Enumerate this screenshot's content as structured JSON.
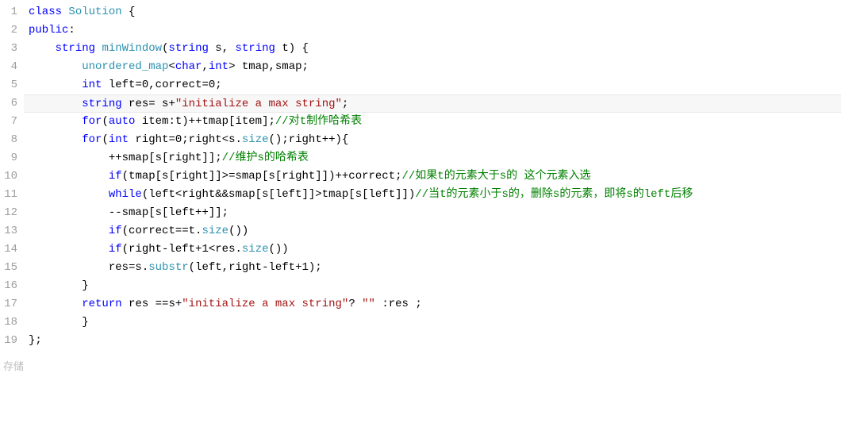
{
  "line_numbers": [
    "1",
    "2",
    "3",
    "4",
    "5",
    "6",
    "7",
    "8",
    "9",
    "10",
    "11",
    "12",
    "13",
    "14",
    "15",
    "16",
    "17",
    "18",
    "19"
  ],
  "code_lines": [
    [
      {
        "t": "class ",
        "c": "kw"
      },
      {
        "t": "Solution",
        "c": "type"
      },
      {
        "t": " {",
        "c": ""
      }
    ],
    [
      {
        "t": "public",
        "c": "kw"
      },
      {
        "t": ":",
        "c": ""
      }
    ],
    [
      {
        "t": "    ",
        "c": ""
      },
      {
        "t": "string",
        "c": "kw"
      },
      {
        "t": " ",
        "c": ""
      },
      {
        "t": "minWindow",
        "c": "type"
      },
      {
        "t": "(",
        "c": ""
      },
      {
        "t": "string",
        "c": "kw"
      },
      {
        "t": " s, ",
        "c": ""
      },
      {
        "t": "string",
        "c": "kw"
      },
      {
        "t": " t) {",
        "c": ""
      }
    ],
    [
      {
        "t": "        ",
        "c": ""
      },
      {
        "t": "unordered_map",
        "c": "type"
      },
      {
        "t": "<",
        "c": ""
      },
      {
        "t": "char",
        "c": "kw"
      },
      {
        "t": ",",
        "c": ""
      },
      {
        "t": "int",
        "c": "kw"
      },
      {
        "t": "> tmap,smap;",
        "c": ""
      }
    ],
    [
      {
        "t": "        ",
        "c": ""
      },
      {
        "t": "int",
        "c": "kw"
      },
      {
        "t": " left=",
        "c": ""
      },
      {
        "t": "0",
        "c": "num"
      },
      {
        "t": ",correct=",
        "c": ""
      },
      {
        "t": "0",
        "c": "num"
      },
      {
        "t": ";",
        "c": ""
      }
    ],
    [
      {
        "t": "        ",
        "c": ""
      },
      {
        "t": "string",
        "c": "kw"
      },
      {
        "t": " res= s+",
        "c": ""
      },
      {
        "t": "\"initialize a max string\"",
        "c": "str"
      },
      {
        "t": ";",
        "c": ""
      }
    ],
    [
      {
        "t": "        ",
        "c": ""
      },
      {
        "t": "for",
        "c": "kw"
      },
      {
        "t": "(",
        "c": ""
      },
      {
        "t": "auto",
        "c": "kw"
      },
      {
        "t": " item:t)++tmap[item];",
        "c": ""
      },
      {
        "t": "//对t制作哈希表",
        "c": "cm"
      }
    ],
    [
      {
        "t": "        ",
        "c": ""
      },
      {
        "t": "for",
        "c": "kw"
      },
      {
        "t": "(",
        "c": ""
      },
      {
        "t": "int",
        "c": "kw"
      },
      {
        "t": " right=",
        "c": ""
      },
      {
        "t": "0",
        "c": "num"
      },
      {
        "t": ";right<s.",
        "c": ""
      },
      {
        "t": "size",
        "c": "type"
      },
      {
        "t": "();right++){",
        "c": ""
      }
    ],
    [
      {
        "t": "            ++smap[s[right]];",
        "c": ""
      },
      {
        "t": "//维护s的哈希表",
        "c": "cm"
      }
    ],
    [
      {
        "t": "            ",
        "c": ""
      },
      {
        "t": "if",
        "c": "kw"
      },
      {
        "t": "(tmap[s[right]]>=smap[s[right]])++correct;",
        "c": ""
      },
      {
        "t": "//如果t的元素大于s的 这个元素入选",
        "c": "cm"
      }
    ],
    [
      {
        "t": "            ",
        "c": ""
      },
      {
        "t": "while",
        "c": "kw"
      },
      {
        "t": "(left<right&&smap[s[left]]>tmap[s[left]])",
        "c": ""
      },
      {
        "t": "//当t的元素小于s的，删除s的元素，即将s的left后移",
        "c": "cm"
      }
    ],
    [
      {
        "t": "            --smap[s[left++]];",
        "c": ""
      }
    ],
    [
      {
        "t": "            ",
        "c": ""
      },
      {
        "t": "if",
        "c": "kw"
      },
      {
        "t": "(correct==t.",
        "c": ""
      },
      {
        "t": "size",
        "c": "type"
      },
      {
        "t": "())",
        "c": ""
      }
    ],
    [
      {
        "t": "            ",
        "c": ""
      },
      {
        "t": "if",
        "c": "kw"
      },
      {
        "t": "(right-left+",
        "c": ""
      },
      {
        "t": "1",
        "c": "num"
      },
      {
        "t": "<res.",
        "c": ""
      },
      {
        "t": "size",
        "c": "type"
      },
      {
        "t": "())",
        "c": ""
      }
    ],
    [
      {
        "t": "            res=s.",
        "c": ""
      },
      {
        "t": "substr",
        "c": "type"
      },
      {
        "t": "(left,right-left+",
        "c": ""
      },
      {
        "t": "1",
        "c": "num"
      },
      {
        "t": ");",
        "c": ""
      }
    ],
    [
      {
        "t": "        }",
        "c": ""
      }
    ],
    [
      {
        "t": "        ",
        "c": ""
      },
      {
        "t": "return",
        "c": "kw"
      },
      {
        "t": " res ==s+",
        "c": ""
      },
      {
        "t": "\"initialize a max string\"",
        "c": "str"
      },
      {
        "t": "? ",
        "c": ""
      },
      {
        "t": "\"\"",
        "c": "str"
      },
      {
        "t": " :res ;",
        "c": ""
      }
    ],
    [
      {
        "t": "        }",
        "c": ""
      }
    ],
    [
      {
        "t": "};",
        "c": ""
      }
    ]
  ],
  "highlight_line": 5,
  "footer": {
    "label": "存储"
  }
}
